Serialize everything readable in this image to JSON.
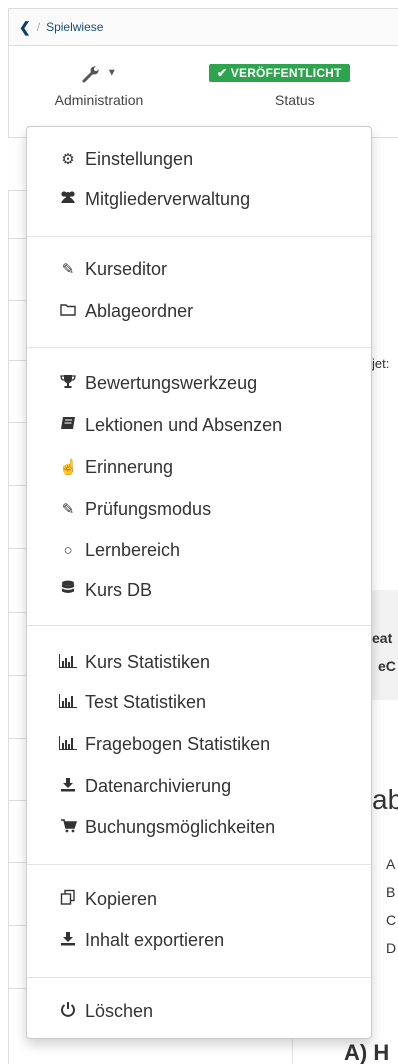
{
  "breadcrumb": {
    "back_icon": "chevron-left-icon",
    "separator": "/",
    "current": "Spielwiese"
  },
  "toolbar": {
    "admin_label": "Administration",
    "status_badge": "✔ VERÖFFENTLICHT",
    "status_label": "Status"
  },
  "background": {
    "t1": "jet:",
    "t2": "eat",
    "t3": "eC",
    "t4": "ab",
    "t5": "A",
    "t6": "B",
    "t7": "C",
    "t8": "D",
    "t9": "A) H"
  },
  "menu": {
    "groups": [
      {
        "items": [
          {
            "icon": "cogs-icon",
            "label": "Einstellungen"
          },
          {
            "icon": "users-icon",
            "label": "Mitgliederverwaltung"
          }
        ]
      },
      {
        "items": [
          {
            "icon": "edit-icon",
            "label": "Kurseditor"
          },
          {
            "icon": "folder-icon",
            "label": "Ablageordner"
          }
        ]
      },
      {
        "items": [
          {
            "icon": "trophy-icon",
            "label": "Bewertungswerkzeug"
          },
          {
            "icon": "book-icon",
            "label": "Lektionen und Absenzen"
          },
          {
            "icon": "hand-pointer-icon",
            "label": "Erinnerung"
          },
          {
            "icon": "edit-icon",
            "label": "Prüfungsmodus"
          },
          {
            "icon": "circle-icon",
            "label": "Lernbereich"
          },
          {
            "icon": "database-icon",
            "label": "Kurs DB"
          }
        ]
      },
      {
        "items": [
          {
            "icon": "bar-chart-icon",
            "label": "Kurs Statistiken"
          },
          {
            "icon": "bar-chart-icon",
            "label": "Test Statistiken"
          },
          {
            "icon": "bar-chart-icon",
            "label": "Fragebogen Statistiken"
          },
          {
            "icon": "download-icon",
            "label": "Datenarchivierung"
          },
          {
            "icon": "cart-icon",
            "label": "Buchungsmöglichkeiten"
          }
        ]
      },
      {
        "items": [
          {
            "icon": "copy-icon",
            "label": "Kopieren"
          },
          {
            "icon": "download-icon",
            "label": "Inhalt exportieren"
          }
        ]
      },
      {
        "items": [
          {
            "icon": "power-icon",
            "label": "Löschen"
          }
        ]
      }
    ]
  }
}
